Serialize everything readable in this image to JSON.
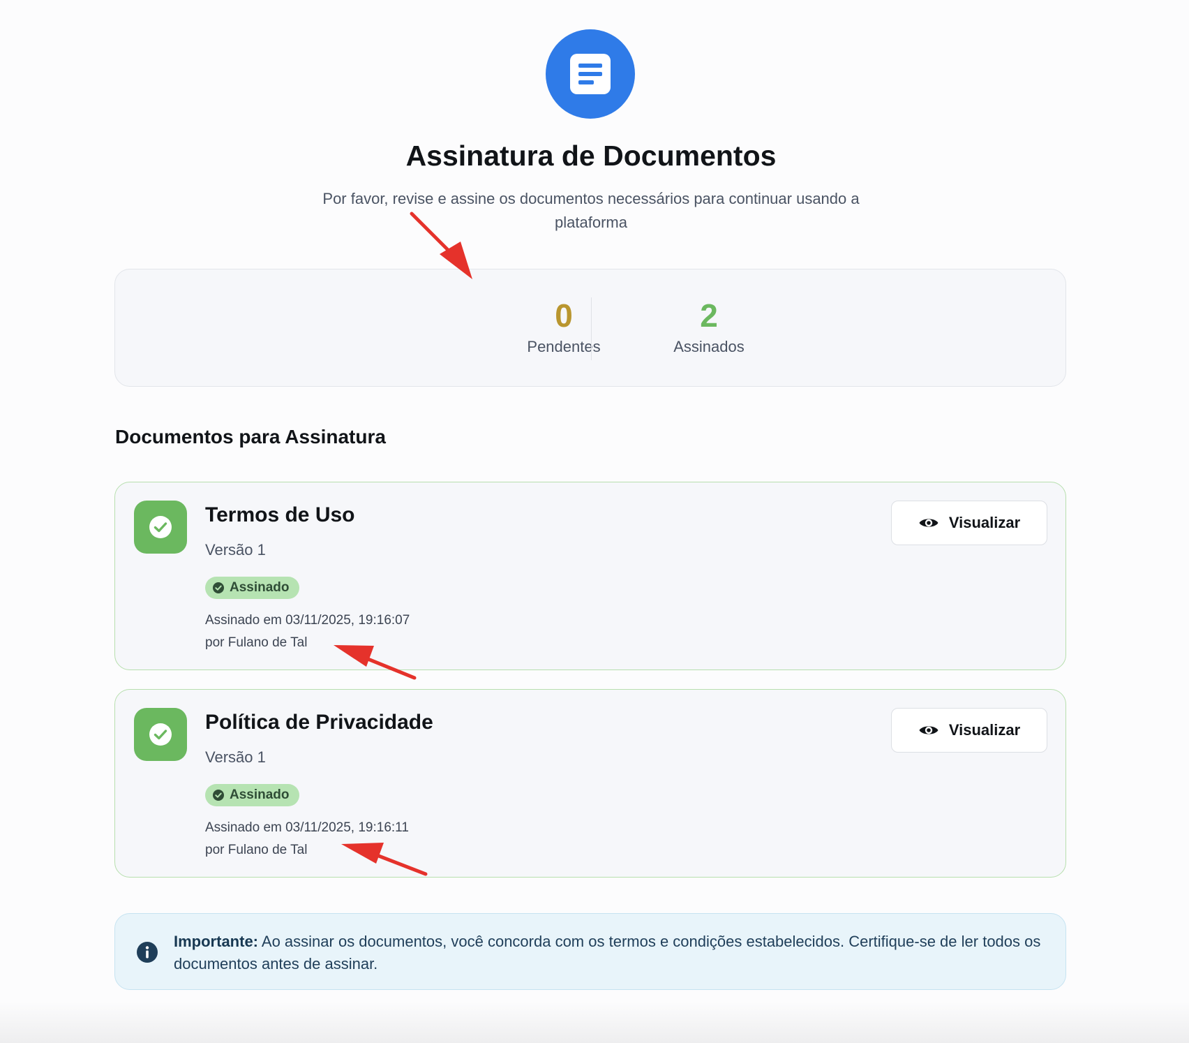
{
  "header": {
    "icon": "document-lines-icon",
    "title": "Assinatura de Documentos",
    "subtitle": "Por favor, revise e assine os documentos necessários para continuar usando a plataforma"
  },
  "stats": {
    "pending": {
      "value": "0",
      "label": "Pendentes",
      "color": "#b9962f"
    },
    "signed": {
      "value": "2",
      "label": "Assinados",
      "color": "#6bb85f"
    }
  },
  "section_title": "Documentos para Assinatura",
  "documents": [
    {
      "title": "Termos de Uso",
      "version": "Versão 1",
      "status": "Assinado",
      "signed_at": "Assinado em 03/11/2025, 19:16:07",
      "signed_by": "por Fulano de Tal",
      "view_label": "Visualizar"
    },
    {
      "title": "Política de Privacidade",
      "version": "Versão 1",
      "status": "Assinado",
      "signed_at": "Assinado em 03/11/2025, 19:16:11",
      "signed_by": "por Fulano de Tal",
      "view_label": "Visualizar"
    }
  ],
  "info": {
    "icon": "info-icon",
    "label": "Importante:",
    "text": " Ao assinar os documentos, você concorda com os termos e condições estabelecidos. Certifique-se de ler todos os documentos antes de assinar."
  },
  "colors": {
    "brand": "#2f7be8",
    "success": "#6bb85f",
    "annotation_arrow": "#e5322b"
  }
}
